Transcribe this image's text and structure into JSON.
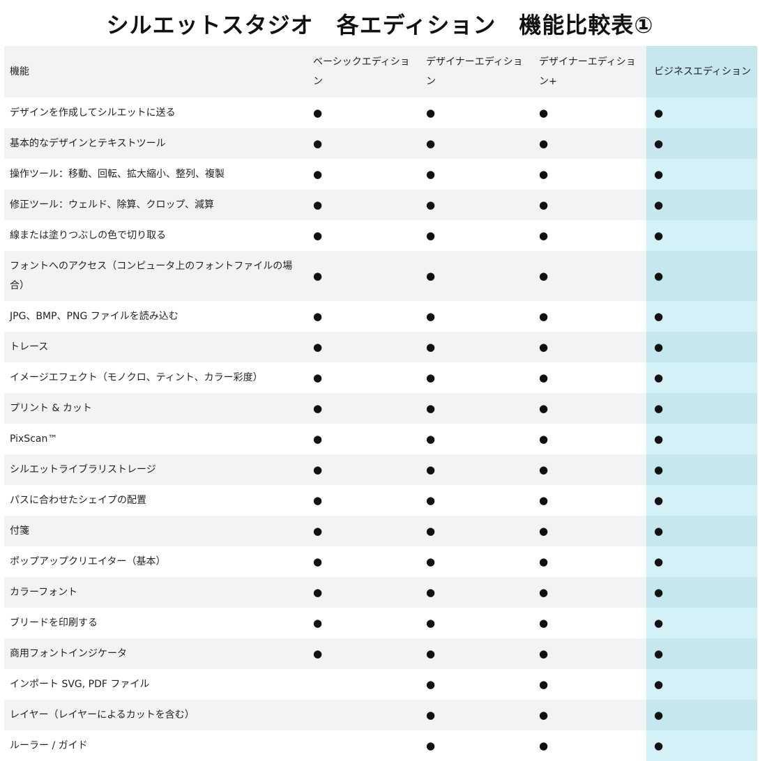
{
  "page": {
    "title": "シルエットスタジオ　各エディション　機能比較表①"
  },
  "table": {
    "headers": [
      "機能",
      "ベーシックエディション",
      "デザイナーエディション",
      "デザイナーエディション+",
      "ビジネスエディション"
    ],
    "mark_symbol": "●",
    "rows": [
      {
        "feature": "デザインを作成してシルエットに送る",
        "marks": [
          "●",
          "●",
          "●",
          "●"
        ]
      },
      {
        "feature": "基本的なデザインとテキストツール",
        "marks": [
          "●",
          "●",
          "●",
          "●"
        ]
      },
      {
        "feature": "操作ツール：移動、回転、拡大縮小、整列、複製",
        "marks": [
          "●",
          "●",
          "●",
          "●"
        ]
      },
      {
        "feature": "修正ツール：ウェルド、除算、クロップ、減算",
        "marks": [
          "●",
          "●",
          "●",
          "●"
        ]
      },
      {
        "feature": "線または塗りつぶしの色で切り取る",
        "marks": [
          "●",
          "●",
          "●",
          "●"
        ]
      },
      {
        "feature": "フォントへのアクセス（コンピュータ上のフォントファイルの場合）",
        "marks": [
          "●",
          "●",
          "●",
          "●"
        ]
      },
      {
        "feature": "JPG、BMP、PNG ファイルを読み込む",
        "marks": [
          "●",
          "●",
          "●",
          "●"
        ]
      },
      {
        "feature": "トレース",
        "marks": [
          "●",
          "●",
          "●",
          "●"
        ]
      },
      {
        "feature": "イメージエフェクト（モノクロ、ティント、カラー彩度）",
        "marks": [
          "●",
          "●",
          "●",
          "●"
        ]
      },
      {
        "feature": "プリント & カット",
        "marks": [
          "●",
          "●",
          "●",
          "●"
        ]
      },
      {
        "feature": "PixScan™",
        "marks": [
          "●",
          "●",
          "●",
          "●"
        ]
      },
      {
        "feature": "シルエットライブラリストレージ",
        "marks": [
          "●",
          "●",
          "●",
          "●"
        ]
      },
      {
        "feature": "パスに合わせたシェイプの配置",
        "marks": [
          "●",
          "●",
          "●",
          "●"
        ]
      },
      {
        "feature": "付箋",
        "marks": [
          "●",
          "●",
          "●",
          "●"
        ]
      },
      {
        "feature": "ポップアップクリエイター（基本）",
        "marks": [
          "●",
          "●",
          "●",
          "●"
        ]
      },
      {
        "feature": "カラーフォント",
        "marks": [
          "●",
          "●",
          "●",
          "●"
        ]
      },
      {
        "feature": "ブリードを印刷する",
        "marks": [
          "●",
          "●",
          "●",
          "●"
        ]
      },
      {
        "feature": "商用フォントインジケータ",
        "marks": [
          "●",
          "●",
          "●",
          "●"
        ]
      },
      {
        "feature": "インポート SVG, PDF ファイル",
        "marks": [
          "",
          "●",
          "●",
          "●"
        ]
      },
      {
        "feature": "レイヤー（レイヤーによるカットを含む）",
        "marks": [
          "",
          "●",
          "●",
          "●"
        ]
      },
      {
        "feature": "ルーラー / ガイド",
        "marks": [
          "",
          "●",
          "●",
          "●"
        ]
      }
    ]
  }
}
